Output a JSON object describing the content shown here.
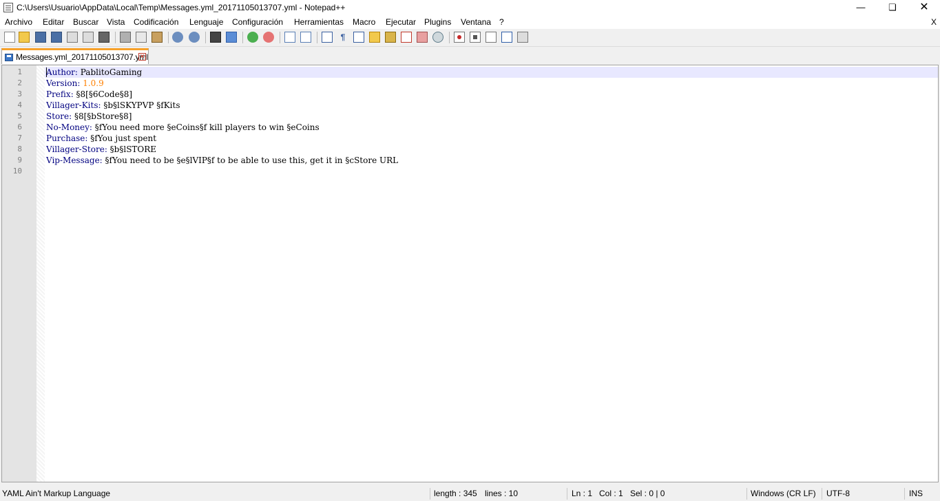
{
  "window": {
    "title": "C:\\Users\\Usuario\\AppData\\Local\\Temp\\Messages.yml_20171105013707.yml - Notepad++",
    "minimize_icon": "minimize-icon",
    "maximize_icon": "restore-icon",
    "close_icon": "close-icon"
  },
  "menu": {
    "items": [
      "Archivo",
      "Editar",
      "Buscar",
      "Vista",
      "Codificación",
      "Lenguaje",
      "Configuración",
      "Herramientas",
      "Macro",
      "Ejecutar",
      "Plugins",
      "Ventana",
      "?"
    ],
    "close_label": "X"
  },
  "toolbar": {
    "icons": [
      "new-file-icon",
      "open-file-icon",
      "save-icon",
      "save-all-icon",
      "close-icon",
      "close-all-icon",
      "print-icon",
      "cut-icon",
      "copy-icon",
      "paste-icon",
      "undo-icon",
      "redo-icon",
      "find-icon",
      "replace-icon",
      "zoom-in-icon",
      "zoom-out-icon",
      "sync-vertical-icon",
      "sync-horizontal-icon",
      "word-wrap-icon",
      "show-all-chars-icon",
      "indent-guide-icon",
      "user-language-icon",
      "document-map-icon",
      "function-list-icon",
      "folder-workspace-icon",
      "monitoring-icon",
      "record-macro-icon",
      "stop-macro-icon",
      "play-macro-icon",
      "run-macro-multiple-icon",
      "save-macro-icon"
    ]
  },
  "tab": {
    "label": "Messages.yml_20171105013707.yml"
  },
  "editor": {
    "line_numbers": [
      "1",
      "2",
      "3",
      "4",
      "5",
      "6",
      "7",
      "8",
      "9",
      "10"
    ],
    "lines": [
      {
        "key": "Author",
        "value": " PablitoGaming"
      },
      {
        "key": "Version",
        "value": " 1.0.9"
      },
      {
        "key": "Prefix",
        "value": " §8[§6Code§8]"
      },
      {
        "key": "Villager-Kits",
        "value": " §b§lSKYPVP §fKits"
      },
      {
        "key": "Store",
        "value": " §8[§bStore§8]"
      },
      {
        "key": "No-Money",
        "value": " §fYou need more §eCoins§f kill players to win §eCoins"
      },
      {
        "key": "Purchase",
        "value": " §fYou just spent"
      },
      {
        "key": "Villager-Store",
        "value": " §b§lSTORE"
      },
      {
        "key": "Vip-Message",
        "value": " §fYou need to be §e§lVIP§f to be able to use this, get it in §cStore URL"
      },
      {
        "key": "",
        "value": ""
      }
    ],
    "colors": {
      "key": "#000080",
      "number": "#ff8000",
      "current_line": "#e8e8ff"
    }
  },
  "status": {
    "language": "YAML Ain't Markup Language",
    "length": "length : 345",
    "lines": "lines : 10",
    "ln": "Ln : 1",
    "col": "Col : 1",
    "sel": "Sel : 0 | 0",
    "eol": "Windows (CR LF)",
    "encoding": "UTF-8",
    "mode": "INS"
  }
}
